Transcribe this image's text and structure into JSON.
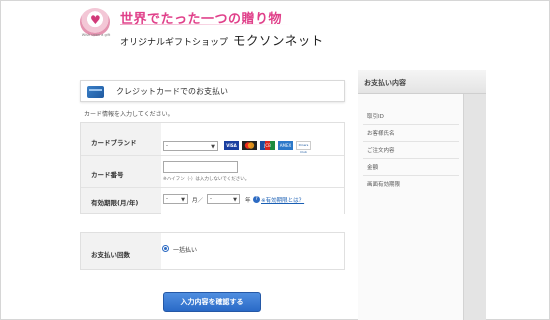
{
  "header": {
    "logo_text": "Wish upon a gift",
    "tagline": "世界でたった一つの贈り物",
    "shop_sub": "オリジナルギフトショップ",
    "shop_main": "モクソンネット"
  },
  "section": {
    "title": "クレジットカードでのお支払い",
    "note": "カード情報を入力してください。"
  },
  "form": {
    "brand_label": "カードブランド",
    "brand_selected": "-",
    "brand_logos": [
      "VISA",
      "MasterCard",
      "JCB",
      "AMEX",
      "Diners Club"
    ],
    "number_label": "カード番号",
    "number_value": "",
    "number_hint": "※ハイフン（-）は入力しないでください。",
    "expiry_label": "有効期限(月/年)",
    "expiry_month": "-",
    "month_unit": "月／",
    "expiry_year": "-",
    "year_unit": "年",
    "expiry_help": "※有効期限とは？"
  },
  "payment": {
    "label": "お支払い回数",
    "option": "一括払い",
    "option_selected": true
  },
  "confirm_label": "入力内容を確認する",
  "summary": {
    "title": "お支払い内容",
    "items": [
      "取引ID",
      "お客様氏名",
      "ご注文内容",
      "金額",
      "画面有効期限"
    ]
  },
  "colors": {
    "accent": "#2a6ac7",
    "tagline": "#e0408a",
    "link": "#1a5fb4"
  }
}
